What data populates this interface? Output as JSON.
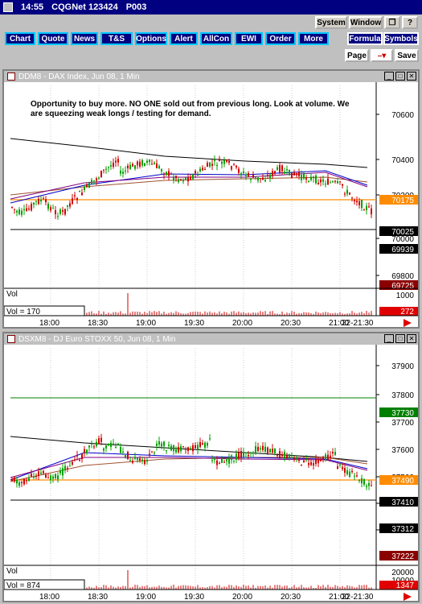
{
  "titlebar": {
    "time": "14:55",
    "app": "CQGNet 123424",
    "page": "P003"
  },
  "nav": [
    "Chart",
    "Quote",
    "News",
    "T&S",
    "Options",
    "Alert",
    "AllCon",
    "EWI",
    "Order",
    "More"
  ],
  "sys": {
    "system": "System",
    "window": "Window",
    "formula": "Formula",
    "symbols": "Symbols",
    "page": "Page",
    "save": "Save"
  },
  "panel1": {
    "title": "DDM8 - DAX Index, Jun 08, 1 Min",
    "note": "Opportunity to buy more. NO ONE sold out from previous long. Look at volume. We are squeezing weak longs / testing for demand.",
    "prices": [
      "70600",
      "70400",
      "70200",
      "70000",
      "69800"
    ],
    "tags": [
      {
        "v": "70175",
        "c": "#ff8c00"
      },
      {
        "v": "70025",
        "c": "#000000"
      },
      {
        "v": "69939",
        "c": "#000000"
      },
      {
        "v": "69725",
        "c": "#8b0000"
      }
    ],
    "vol_label": "Vol",
    "vol_readout": "Vol = 170",
    "vol_scale": "1000",
    "vol_tag": "272",
    "times": [
      "18:00",
      "18:30",
      "19:00",
      "19:30",
      "20:00",
      "20:30",
      "21:00",
      "22-21:30"
    ]
  },
  "panel2": {
    "title": "DSXM8 - DJ Euro STOXX 50, Jun 08, 1 Min",
    "prices": [
      "37900",
      "37800",
      "37700",
      "37600",
      "37500",
      "37400",
      "37300"
    ],
    "tags": [
      {
        "v": "37730",
        "c": "#008000"
      },
      {
        "v": "37490",
        "c": "#ff8c00"
      },
      {
        "v": "37410",
        "c": "#000000"
      },
      {
        "v": "37312",
        "c": "#000000"
      },
      {
        "v": "37222",
        "c": "#8b0000"
      }
    ],
    "vol_label": "Vol",
    "vol_readout": "Vol = 874",
    "vol_scale": "20000",
    "vol_scale2": "10000",
    "vol_tag": "1347",
    "times": [
      "18:00",
      "18:30",
      "19:00",
      "19:30",
      "20:00",
      "20:30",
      "21:00",
      "22-21:30"
    ]
  }
}
